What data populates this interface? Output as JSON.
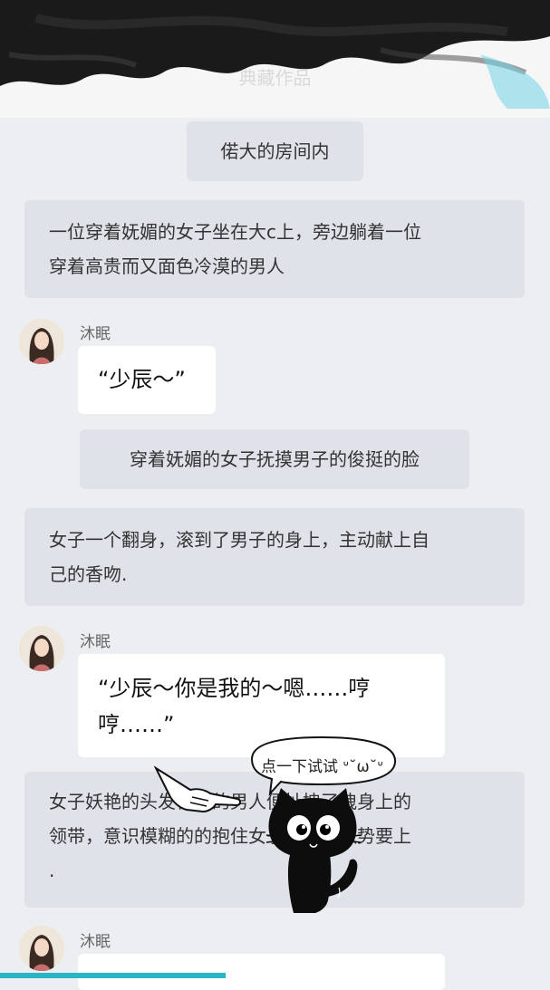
{
  "header": {
    "title": "典藏作品"
  },
  "scene": {
    "title": "偌大的房间内"
  },
  "messages": [
    {
      "type": "narration",
      "text_line1": "一位穿着妩媚的女子坐在大c上，旁边躺着一位",
      "text_line2": "穿着高贵而又面色冷漠的男人"
    },
    {
      "type": "dialogue",
      "speaker": "沐眠",
      "text": "“少辰～”"
    },
    {
      "type": "action",
      "text": "穿着妩媚的女子抚摸男子的俊挺的脸"
    },
    {
      "type": "narration",
      "text_line1": "女子一个翻身，滚到了男子的身上，主动献上自",
      "text_line2": "己的香吻."
    },
    {
      "type": "dialogue",
      "speaker": "沐眠",
      "text_line1": "“少辰～你是我的～嗯……哼",
      "text_line2": "哼……”"
    },
    {
      "type": "narration",
      "text_line1": "女子妖艳的头发在旁的男人便扯拽了拽身上的",
      "text_line2": "领带，意识模糊的的抱住女子细腰，做势要上",
      "text_line3": "."
    },
    {
      "type": "dialogue",
      "speaker": "沐眠",
      "text": ""
    }
  ],
  "hint": {
    "text": "点一下试试 ᐡ˘ω˘ᐡ",
    "icons": [
      "pointing-hand-icon",
      "black-cat-icon"
    ]
  },
  "progress": {
    "fraction": 0.41,
    "color": "#29b6c4"
  }
}
